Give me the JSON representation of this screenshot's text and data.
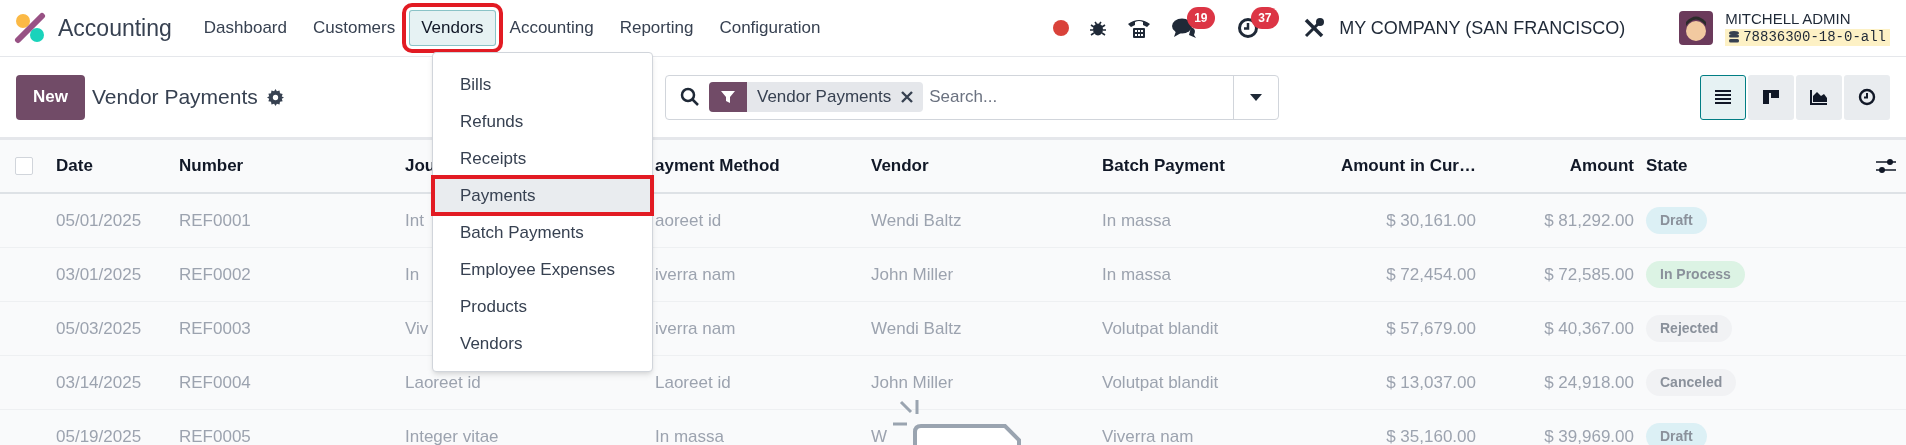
{
  "app": {
    "name": "Accounting"
  },
  "menu": [
    {
      "label": "Dashboard",
      "selected": false,
      "annotated": false
    },
    {
      "label": "Customers",
      "selected": false,
      "annotated": false
    },
    {
      "label": "Vendors",
      "selected": true,
      "annotated": true
    },
    {
      "label": "Accounting",
      "selected": false,
      "annotated": false
    },
    {
      "label": "Reporting",
      "selected": false,
      "annotated": false
    },
    {
      "label": "Configuration",
      "selected": false,
      "annotated": false
    }
  ],
  "systray": {
    "chat_count": "19",
    "activity_count": "37",
    "company": "MY COMPANY (SAN FRANCISCO)",
    "user": "MITCHELL ADMIN",
    "database": "78836300-18-0-all"
  },
  "control_panel": {
    "new_button": "New",
    "title": "Vendor Payments",
    "facet": "Vendor Payments",
    "search_placeholder": "Search...",
    "views": [
      {
        "kind": "list",
        "selected": true
      },
      {
        "kind": "kanban",
        "selected": false
      },
      {
        "kind": "graph",
        "selected": false
      },
      {
        "kind": "activity",
        "selected": false
      }
    ]
  },
  "dropdown": {
    "items": [
      {
        "label": "Bills",
        "selected": false,
        "annotated": false
      },
      {
        "label": "Refunds",
        "selected": false,
        "annotated": false
      },
      {
        "label": "Receipts",
        "selected": false,
        "annotated": false
      },
      {
        "label": "Payments",
        "selected": true,
        "annotated": true
      },
      {
        "label": "Batch Payments",
        "selected": false,
        "annotated": false
      },
      {
        "label": "Employee Expenses",
        "selected": false,
        "annotated": false
      },
      {
        "label": "Products",
        "selected": false,
        "annotated": false
      },
      {
        "label": "Vendors",
        "selected": false,
        "annotated": false
      }
    ]
  },
  "table": {
    "select_all_checked": false,
    "columns": [
      "Date",
      "Number",
      "Jou",
      "ayment Method",
      "Vendor",
      "Batch Payment",
      "Amount in Cur…",
      "Amount",
      "State"
    ],
    "rows": [
      {
        "cells": [
          "05/01/2025",
          "REF0001",
          "Int",
          "aoreet id",
          "Wendi Baltz",
          "In massa",
          "$ 30,161.00",
          "$ 81,292.00"
        ],
        "state": "Draft",
        "color": "#dcf0f5"
      },
      {
        "cells": [
          "03/01/2025",
          "REF0002",
          "In",
          "iverra nam",
          "John Miller",
          "In massa",
          "$ 72,454.00",
          "$ 72,585.00"
        ],
        "state": "In Process",
        "color": "#dcf3e4"
      },
      {
        "cells": [
          "05/03/2025",
          "REF0003",
          "Viv",
          "iverra nam",
          "Wendi Baltz",
          "Volutpat blandit",
          "$ 57,679.00",
          "$ 40,367.00"
        ],
        "state": "Rejected",
        "color": "#f1f2f4"
      },
      {
        "cells": [
          "03/14/2025",
          "REF0004",
          "Laoreet id",
          "Laoreet id",
          "John Miller",
          "Volutpat blandit",
          "$ 13,037.00",
          "$ 24,918.00"
        ],
        "state": "Canceled",
        "color": "#f1f2f4"
      },
      {
        "cells": [
          "05/19/2025",
          "REF0005",
          "Integer vitae",
          "In massa",
          "W",
          "Viverra nam",
          "$ 35,160.00",
          "$ 39,969.00"
        ],
        "state": "Draft",
        "color": "#dcf0f5"
      }
    ]
  }
}
